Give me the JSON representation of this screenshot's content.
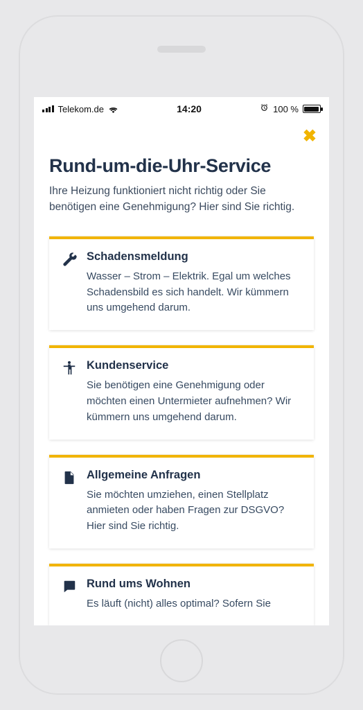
{
  "statusbar": {
    "carrier": "Telekom.de",
    "time": "14:20",
    "battery_pct": "100 %"
  },
  "page": {
    "title": "Rund-um-die-Uhr-Service",
    "subtitle": "Ihre Heizung funktioniert nicht richtig oder Sie benötigen eine Genehmigung? Hier sind Sie richtig."
  },
  "cards": [
    {
      "icon": "wrench-icon",
      "title": "Schadensmeldung",
      "desc": "Wasser – Strom – Elektrik. Egal um welches Schadensbild es sich handelt. Wir kümmern uns umgehend darum."
    },
    {
      "icon": "person-icon",
      "title": "Kundenservice",
      "desc": "Sie benötigen eine Genehmigung oder möchten einen Untermieter aufnehmen? Wir kümmern uns umgehend darum."
    },
    {
      "icon": "document-icon",
      "title": "Allgemeine Anfragen",
      "desc": "Sie möchten umziehen, einen Stellplatz anmieten oder haben Fragen zur DSGVO? Hier sind Sie richtig."
    },
    {
      "icon": "chat-icon",
      "title": "Rund ums Wohnen",
      "desc": "Es läuft (nicht) alles optimal? Sofern Sie"
    }
  ]
}
